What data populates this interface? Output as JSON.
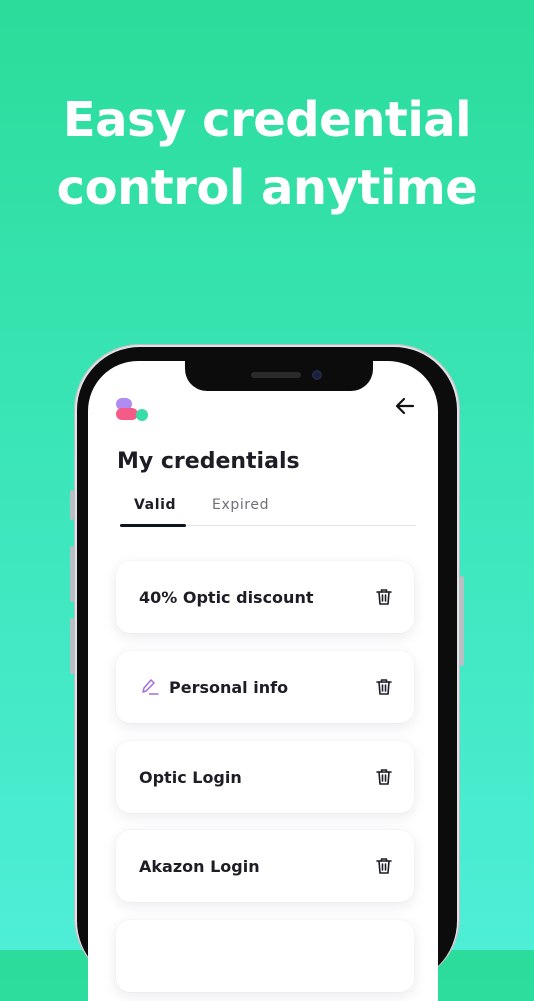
{
  "headline": {
    "line1": "Easy credential",
    "line2": "control anytime"
  },
  "app": {
    "title": "My credentials",
    "tabs": [
      {
        "label": "Valid",
        "active": true
      },
      {
        "label": "Expired",
        "active": false
      }
    ],
    "credentials": [
      {
        "label": "40% Optic discount",
        "icon": "none"
      },
      {
        "label": "Personal info",
        "icon": "pen-icon"
      },
      {
        "label": "Optic Login",
        "icon": "none"
      },
      {
        "label": "Akazon Login",
        "icon": "none"
      }
    ]
  },
  "colors": {
    "background_top": "#2bdc9a",
    "background_bottom": "#4eeed7",
    "text_dark": "#1d1d26",
    "pen_icon": "#a46be0"
  }
}
